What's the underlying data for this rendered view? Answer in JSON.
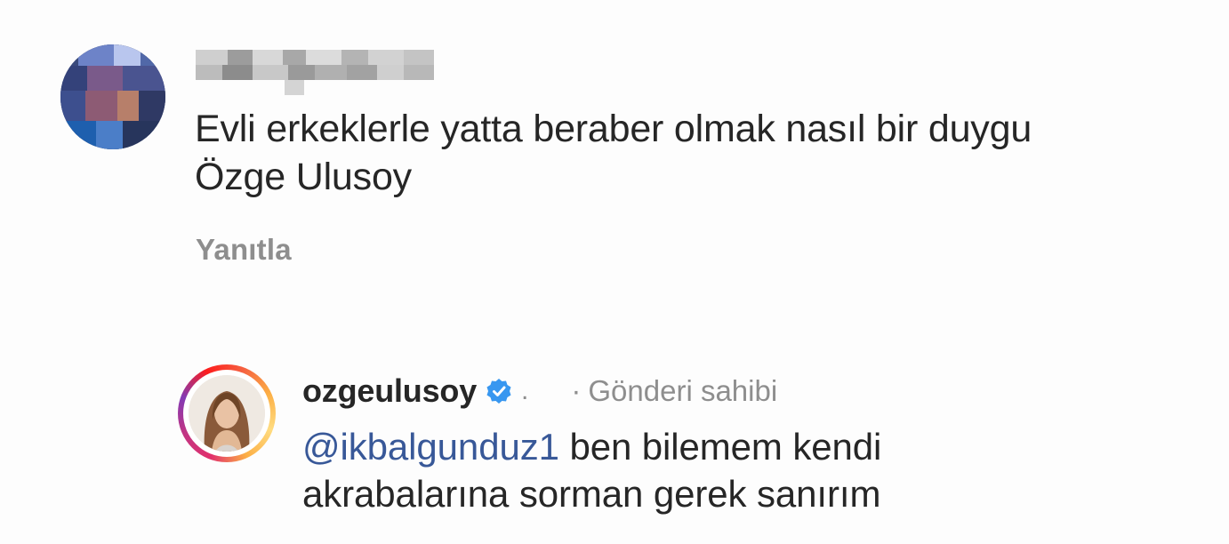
{
  "comment": {
    "text_line_1": "Evli erkeklerle yatta beraber olmak nasıl bir duygu",
    "text_line_2": "Özge Ulusoy",
    "reply_label": "Yanıtla"
  },
  "reply": {
    "username": "ozgeulusoy",
    "verified_icon": "verified-badge-icon",
    "separator": ".",
    "owner_prefix": "·",
    "owner_label": "Gönderi sahibi",
    "mention": "@ikbalgunduz1",
    "text_after_mention": " ben bilemem kendi",
    "text_line_2": "akrabalarına sorman gerek sanırım"
  },
  "colors": {
    "text": "#262626",
    "secondary": "#8e8e8e",
    "mention": "#385898",
    "verified": "#3897f0"
  }
}
